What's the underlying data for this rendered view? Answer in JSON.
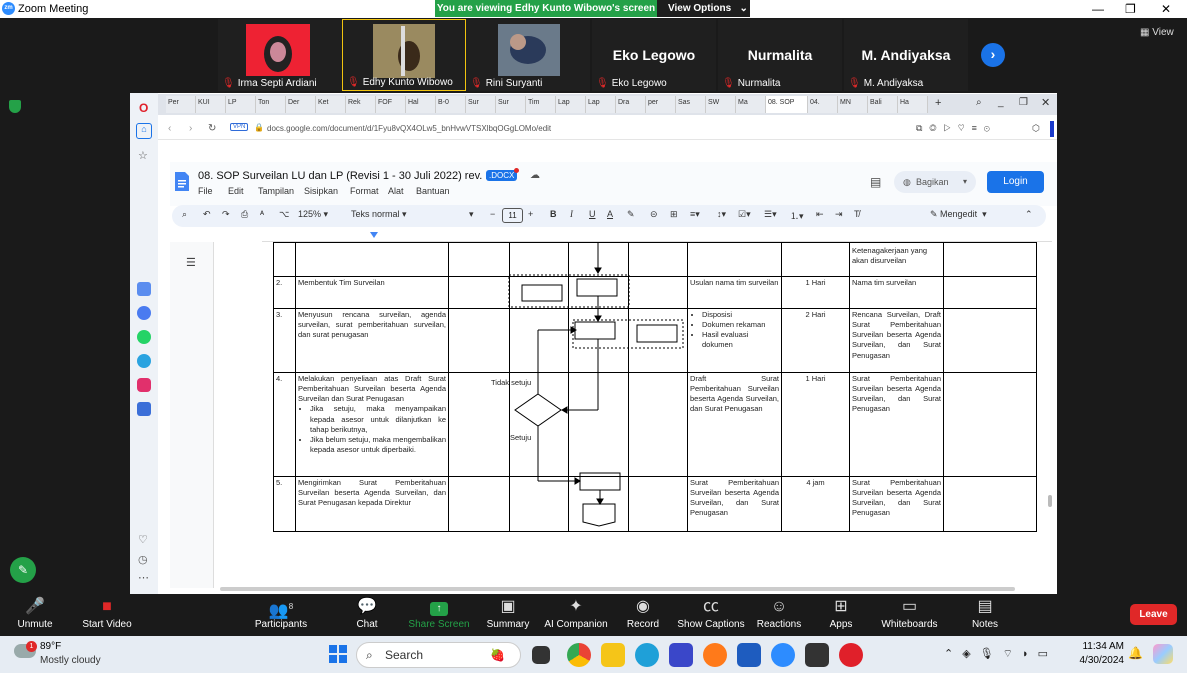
{
  "zoom": {
    "window_title": "Zoom Meeting",
    "banner": "You are viewing Edhy Kunto Wibowo's screen",
    "view_options": "View Options",
    "view_label": "View",
    "participants": [
      {
        "name": "Irma Septi Ardiani",
        "display": ""
      },
      {
        "name": "Edhy Kunto Wibowo",
        "display": ""
      },
      {
        "name": "Rini Suryanti",
        "display": ""
      },
      {
        "name": "Eko Legowo",
        "display": "Eko Legowo"
      },
      {
        "name": "Nurmalita",
        "display": "Nurmalita"
      },
      {
        "name": "M. Andiyaksa",
        "display": "M. Andiyaksa"
      }
    ],
    "controls": {
      "unmute": "Unmute",
      "start_video": "Start Video",
      "participants": "Participants",
      "participants_count": "8",
      "chat": "Chat",
      "share_screen": "Share Screen",
      "summary": "Summary",
      "ai_companion": "AI Companion",
      "record": "Record",
      "captions": "Show Captions",
      "reactions": "Reactions",
      "apps": "Apps",
      "whiteboards": "Whiteboards",
      "notes": "Notes",
      "leave": "Leave"
    }
  },
  "browser": {
    "tabs": [
      "Per",
      "KUI",
      "LP",
      "Ton",
      "Der",
      "Ket",
      "Rek",
      "FOF",
      "Hal",
      "B-0",
      "Sur",
      "Sur",
      "Tim",
      "Lap",
      "Lap",
      "Dra",
      "per",
      "Sas",
      "SW",
      "Ma",
      "08. SOP",
      "04.",
      "MN",
      "Bali",
      "Ha"
    ],
    "active_tab": 20,
    "url": "docs.google.com/document/d/1Fyu8vQX4OLw5_bnHvwVTSXlbqOGgLOMo/edit",
    "vpn": "VPN"
  },
  "docs": {
    "title": "08. SOP Surveilan LU dan LP (Revisi 1 - 30 Juli 2022) rev. 1b",
    "badge": ".DOCX",
    "menu": [
      "File",
      "Edit",
      "Tampilan",
      "Sisipkan",
      "Format",
      "Alat",
      "Bantuan"
    ],
    "bagikan": "Bagikan",
    "login": "Login",
    "zoom": "125%",
    "style": "Teks normal",
    "font_size": "11",
    "mode": "Mengedit"
  },
  "sop": {
    "top_cell": "Ketenagakerjaan yang akan disurveilan",
    "rows": [
      {
        "no": "2.",
        "activity": "Membentuk Tim Surveilan",
        "output": "Usulan nama tim surveilan",
        "time": "1 Hari",
        "result": "Nama tim surveilan"
      },
      {
        "no": "3.",
        "activity": "Menyusun rencana surveilan, agenda surveilan, surat pemberitahuan surveilan, dan surat penugasan",
        "output_items": [
          "Disposisi",
          "Dokumen rekaman",
          "Hasil evaluasi dokumen"
        ],
        "time": "2 Hari",
        "result": "Rencana Surveilan, Draft Surat Pemberitahuan Surveilan beserta Agenda Surveilan, dan Surat Penugasan"
      },
      {
        "no": "4.",
        "activity": "Melakukan penyeliaan atas Draft Surat Pemberitahuan Surveilan beserta Agenda Surveilan dan Surat Penugasan",
        "activity_items": [
          "Jika setuju, maka menyampaikan kepada asesor untuk dilanjutkan ke tahap berikutnya,",
          "Jika belum setuju, maka mengembalikan kepada asesor untuk diperbaiki."
        ],
        "output": "Draft Surat Pemberitahuan Surveilan beserta Agenda Surveilan, dan Surat Penugasan",
        "time": "1 Hari",
        "result": "Surat Pemberitahuan Surveilan beserta Agenda Surveilan, dan Surat Penugasan"
      },
      {
        "no": "5.",
        "activity": "Mengirimkan Surat Pemberitahuan Surveilan beserta Agenda Surveilan, dan Surat Penugasan kepada Direktur",
        "output": "Surat Pemberitahuan Surveilan beserta Agenda Surveilan, dan Surat Penugasan",
        "time": "4 jam",
        "result": "Surat Pemberitahuan Surveilan beserta Agenda Surveilan, dan Surat Penugasan"
      }
    ],
    "flow_labels": {
      "tidak_setuju": "Tidak setuju",
      "setuju": "Setuju"
    }
  },
  "taskbar": {
    "weather_temp": "89°F",
    "weather_desc": "Mostly cloudy",
    "weather_badge": "1",
    "search": "Search",
    "time": "11:34 AM",
    "date": "4/30/2024"
  },
  "colors": {
    "zoom_green": "#24a148",
    "leave_red": "#e02828",
    "docs_blue": "#1a73e8"
  }
}
